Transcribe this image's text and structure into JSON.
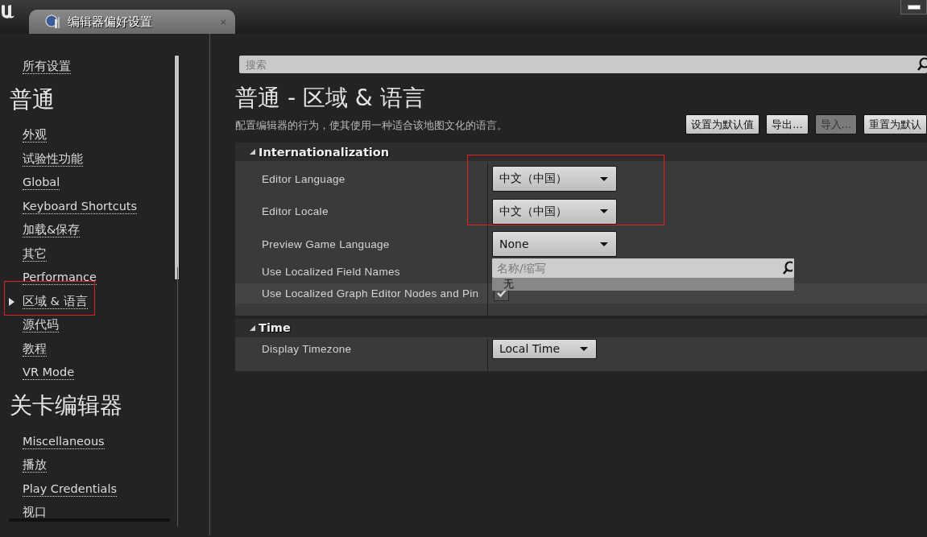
{
  "window": {
    "tab_title": "编辑器偏好设置",
    "tab_close": "×"
  },
  "sidebar": {
    "items": [
      {
        "kind": "link",
        "label": "所有设置",
        "selected": false
      },
      {
        "kind": "heading",
        "label": "普通"
      },
      {
        "kind": "link",
        "label": "外观",
        "selected": false
      },
      {
        "kind": "link",
        "label": "试验性功能",
        "selected": false
      },
      {
        "kind": "link",
        "label": "Global",
        "selected": false
      },
      {
        "kind": "link",
        "label": "Keyboard Shortcuts",
        "selected": false
      },
      {
        "kind": "link",
        "label": "加载&保存",
        "selected": false
      },
      {
        "kind": "link",
        "label": "其它",
        "selected": false
      },
      {
        "kind": "link",
        "label": "Performance",
        "selected": false
      },
      {
        "kind": "link",
        "label": "区域 & 语言",
        "selected": true
      },
      {
        "kind": "link",
        "label": "源代码",
        "selected": false
      },
      {
        "kind": "link",
        "label": "教程",
        "selected": false
      },
      {
        "kind": "link",
        "label": "VR Mode",
        "selected": false
      },
      {
        "kind": "heading",
        "label": "关卡编辑器"
      },
      {
        "kind": "link",
        "label": "Miscellaneous",
        "selected": false
      },
      {
        "kind": "link",
        "label": "播放",
        "selected": false
      },
      {
        "kind": "link",
        "label": "Play Credentials",
        "selected": false
      },
      {
        "kind": "link",
        "label": "视口",
        "selected": false
      }
    ]
  },
  "search": {
    "placeholder": "搜索"
  },
  "page": {
    "title": "普通 - 区域 & 语言",
    "description": "配置编辑器的行为，使其使用一种适合该地图文化的语言。"
  },
  "buttons": [
    {
      "label": "设置为默认值",
      "disabled": false
    },
    {
      "label": "导出...",
      "disabled": false
    },
    {
      "label": "导入...",
      "disabled": true
    },
    {
      "label": "重置为默认",
      "disabled": false
    }
  ],
  "sections": [
    {
      "title": "Internationalization",
      "expanded": true,
      "properties": [
        {
          "kind": "dropdown",
          "label": "Editor Language",
          "value": "中文（中国）"
        },
        {
          "kind": "dropdown",
          "label": "Editor Locale",
          "value": "中文（中国）"
        },
        {
          "kind": "dropdown",
          "label": "Preview Game Language",
          "value": "None",
          "menu": {
            "placeholder": "名称/缩写",
            "items": [
              {
                "label": "无",
                "selected": true
              }
            ]
          }
        },
        {
          "kind": "hidden",
          "label": "Use Localized Field Names"
        },
        {
          "kind": "checkbox",
          "label": "Use Localized Graph Editor Nodes and Pin",
          "checked": true
        }
      ]
    },
    {
      "title": "Time",
      "expanded": true,
      "properties": [
        {
          "kind": "compact-dropdown",
          "label": "Display Timezone",
          "value": "Local Time"
        }
      ]
    }
  ]
}
